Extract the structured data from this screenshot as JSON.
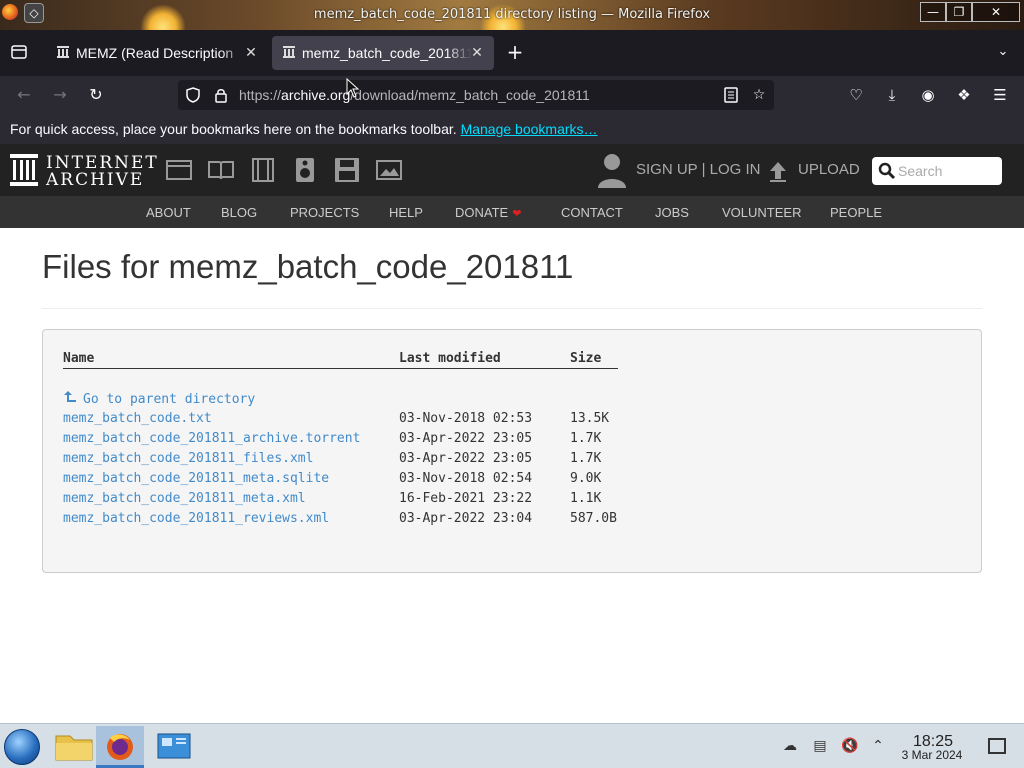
{
  "window": {
    "title": "memz_batch_code_201811 directory listing — Mozilla Firefox"
  },
  "tabs": [
    {
      "label": "MEMZ (Read Description"
    },
    {
      "label": "memz_batch_code_201811"
    }
  ],
  "address_bar": {
    "prefix": "https://",
    "domain": "archive.org",
    "path": "/download/memz_batch_code_201811"
  },
  "bookmarks_bar": {
    "message": "For quick access, place your bookmarks here on the bookmarks toolbar.",
    "manage_link": "Manage bookmarks…"
  },
  "ia_header": {
    "logo_line1": "INTERNET",
    "logo_line2": "ARCHIVE",
    "signup_login": "SIGN UP | LOG IN",
    "upload": "UPLOAD",
    "search_placeholder": "Search",
    "nav": [
      "ABOUT",
      "BLOG",
      "PROJECTS",
      "HELP",
      "DONATE",
      "CONTACT",
      "JOBS",
      "VOLUNTEER",
      "PEOPLE"
    ]
  },
  "main": {
    "title": "Files for memz_batch_code_201811",
    "table": {
      "headers": [
        "Name",
        "Last modified",
        "Size"
      ],
      "parent_link": "Go to parent directory",
      "rows": [
        {
          "name": "memz_batch_code.txt",
          "modified": "03-Nov-2018 02:53",
          "size": "13.5K"
        },
        {
          "name": "memz_batch_code_201811_archive.torrent",
          "modified": "03-Apr-2022 23:05",
          "size": "1.7K"
        },
        {
          "name": "memz_batch_code_201811_files.xml",
          "modified": "03-Apr-2022 23:05",
          "size": "1.7K"
        },
        {
          "name": "memz_batch_code_201811_meta.sqlite",
          "modified": "03-Nov-2018 02:54",
          "size": "9.0K"
        },
        {
          "name": "memz_batch_code_201811_meta.xml",
          "modified": "16-Feb-2021 23:22",
          "size": "1.1K"
        },
        {
          "name": "memz_batch_code_201811_reviews.xml",
          "modified": "03-Apr-2022 23:04",
          "size": "587.0B"
        }
      ]
    }
  },
  "taskbar": {
    "time": "18:25",
    "date": "3 Mar 2024"
  },
  "colors": {
    "link": "#428bca",
    "ia_dark": "#222222",
    "ia_nav": "#333333",
    "firefox_chrome": "#2b2a33",
    "donate_heart": "#e02020"
  }
}
